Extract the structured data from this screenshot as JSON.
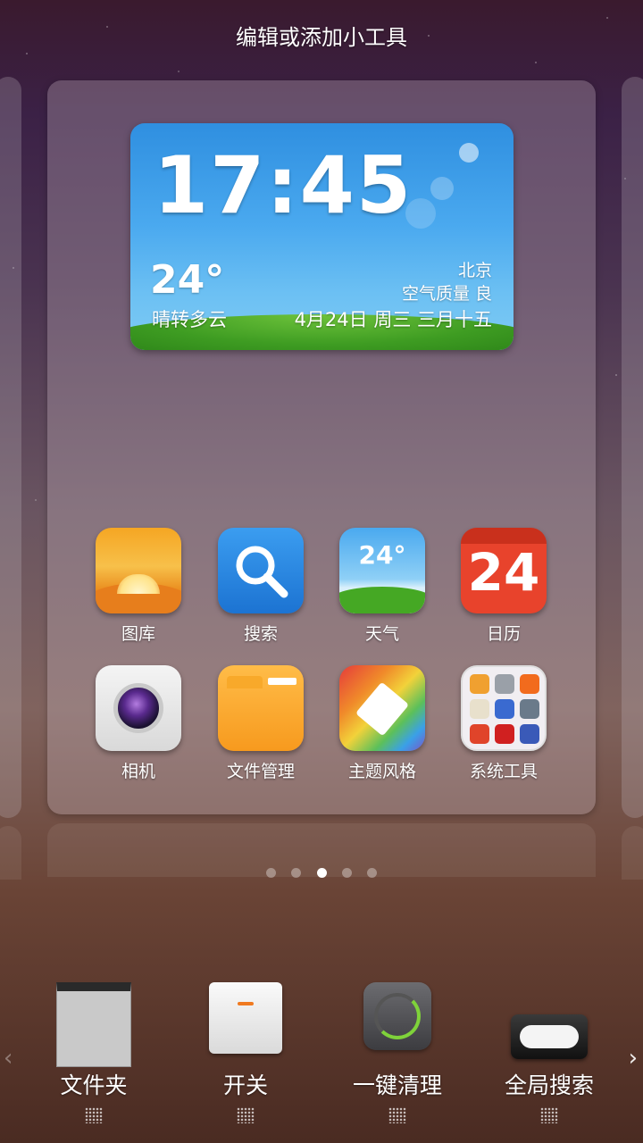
{
  "header": {
    "title": "编辑或添加小工具"
  },
  "weather_widget": {
    "time": "17:45",
    "temperature": "24°",
    "condition": "晴转多云",
    "city": "北京",
    "air_quality": "空气质量 良",
    "date": "4月24日 周三 三月十五"
  },
  "apps": [
    {
      "label": "图库",
      "icon": "gallery-icon"
    },
    {
      "label": "搜索",
      "icon": "search-icon"
    },
    {
      "label": "天气",
      "icon": "weather-icon",
      "icon_text": "24°"
    },
    {
      "label": "日历",
      "icon": "calendar-icon",
      "icon_text": "24"
    },
    {
      "label": "相机",
      "icon": "camera-icon"
    },
    {
      "label": "文件管理",
      "icon": "files-icon"
    },
    {
      "label": "主题风格",
      "icon": "theme-icon"
    },
    {
      "label": "系统工具",
      "icon": "folder-icon"
    }
  ],
  "page_indicator": {
    "total": 5,
    "active": 3
  },
  "widget_tray": {
    "items": [
      {
        "label": "文件夹",
        "thumb": "folder-widget-thumb"
      },
      {
        "label": "开关",
        "thumb": "switch-widget-thumb"
      },
      {
        "label": "一键清理",
        "thumb": "clean-widget-thumb"
      },
      {
        "label": "全局搜索",
        "thumb": "search-widget-thumb"
      }
    ],
    "arrow_left": "‹",
    "arrow_right": "›"
  }
}
